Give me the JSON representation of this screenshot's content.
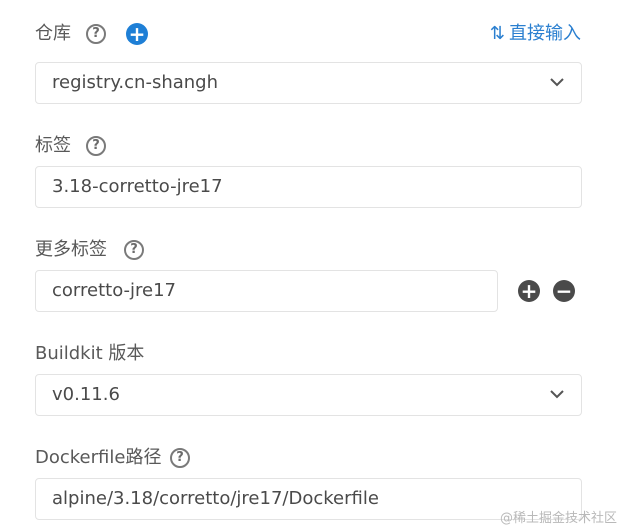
{
  "repository": {
    "label": "仓库",
    "direct_input_label": "直接输入",
    "value": "registry.cn-shangh"
  },
  "tag": {
    "label": "标签",
    "value": "3.18-corretto-jre17"
  },
  "more_tags": {
    "label": "更多标签",
    "value": "corretto-jre17"
  },
  "buildkit": {
    "label": "Buildkit 版本",
    "value": "v0.11.6"
  },
  "dockerfile": {
    "label": "Dockerfile路径",
    "value": "alpine/3.18/corretto/jre17/Dockerfile"
  },
  "icons": {
    "help": "?",
    "plus": "+",
    "minus": "−",
    "swap": "⇅"
  },
  "colors": {
    "accent": "#1e7fd6",
    "dark_button": "#4a4a4a",
    "border": "#e3e3e3"
  },
  "watermark": "@稀土掘金技术社区"
}
